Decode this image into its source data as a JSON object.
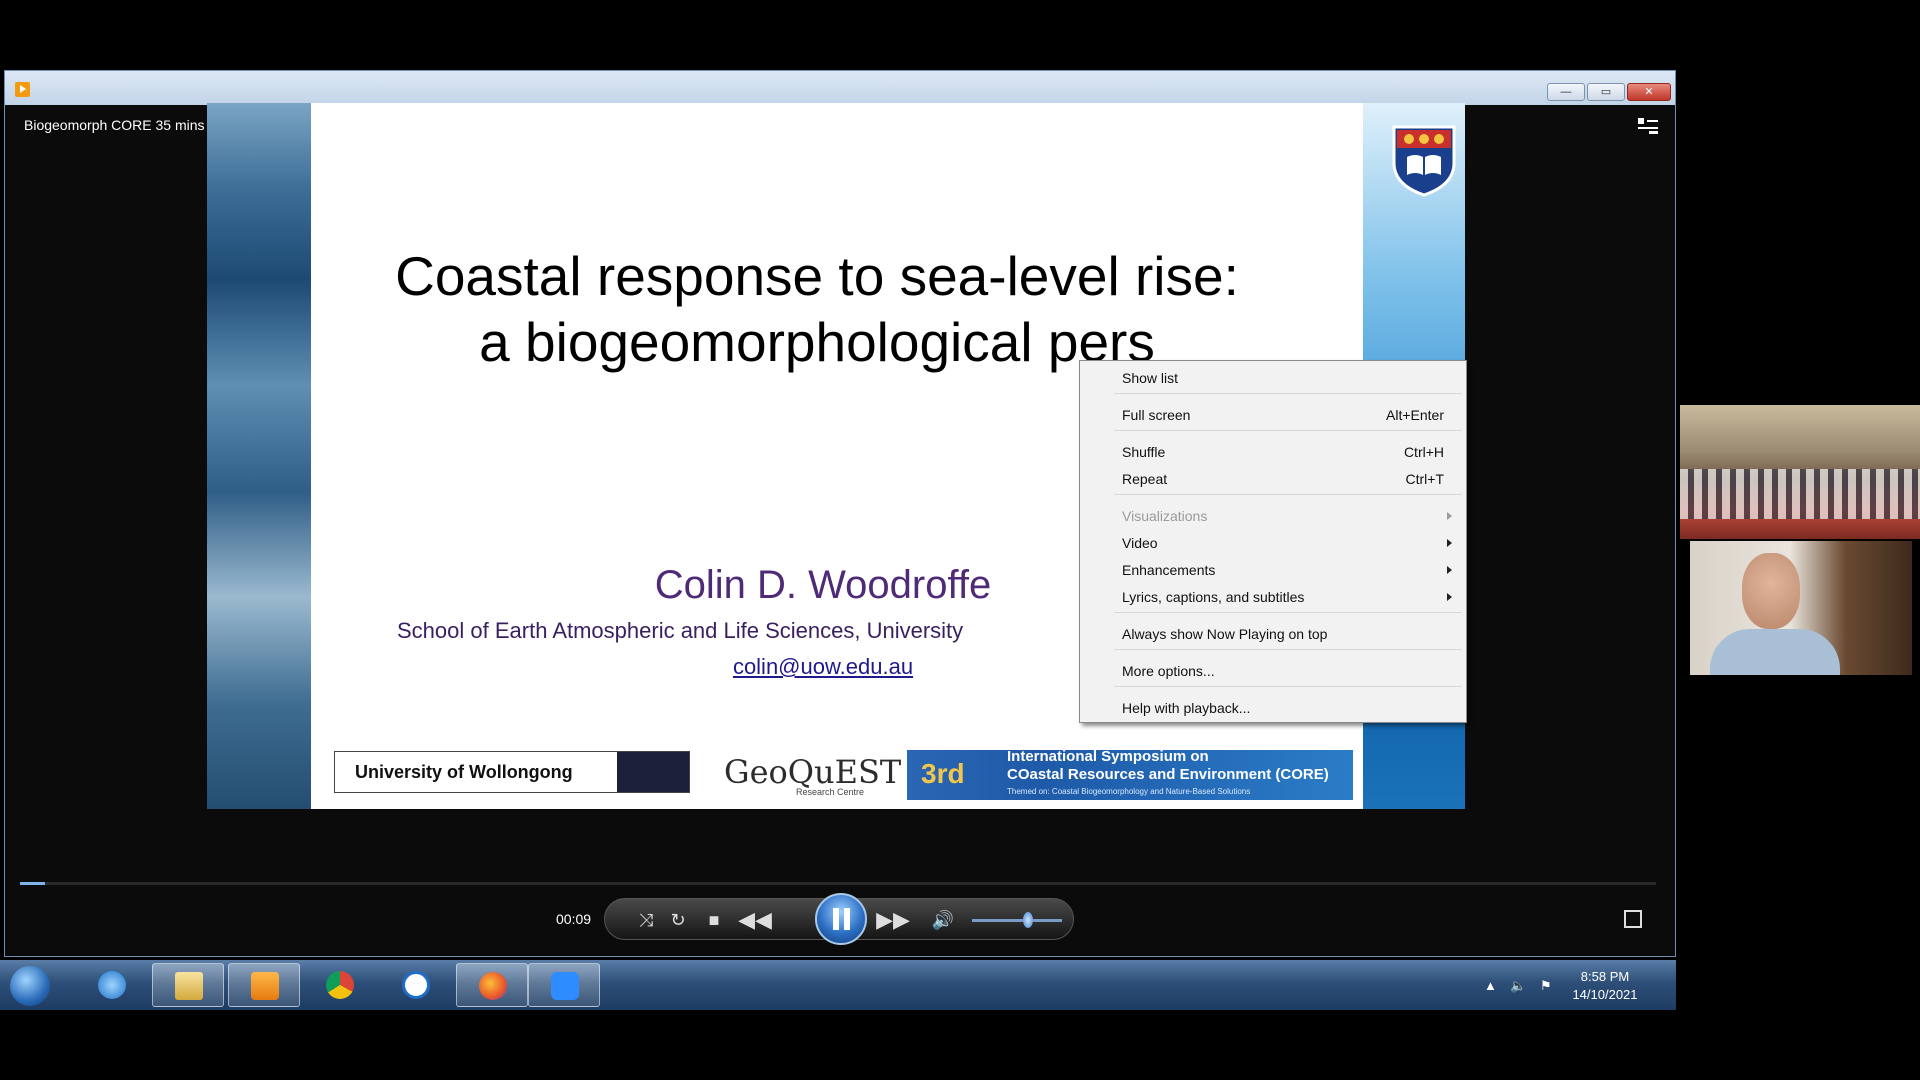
{
  "window": {
    "title": "Biogeomorph CORE 35 mins",
    "controls": {
      "minimize": "—",
      "maximize": "▭",
      "close": "✕"
    }
  },
  "slide": {
    "title": "Coastal response to sea-level rise:\na biogeomorphological pers",
    "author": "Colin D. Woodroffe",
    "affiliation": "School of Earth Atmospheric and Life Sciences, University",
    "email": "colin@uow.edu.au",
    "logos": {
      "uow": "University of Wollongong",
      "geoquest": "GeoQuEST",
      "geoquest_sub": "Research Centre",
      "core_ordinal": "3rd",
      "core_line1": "International Symposium on",
      "core_line2": "COastal Resources and Environment (CORE)",
      "core_line3": "Themed on: Coastal Biogeomorphology and Nature-Based Solutions"
    }
  },
  "context_menu": {
    "items": [
      {
        "label": "Show list",
        "shortcut": ""
      },
      {
        "label": "Full screen",
        "shortcut": "Alt+Enter"
      },
      {
        "label": "Shuffle",
        "shortcut": "Ctrl+H"
      },
      {
        "label": "Repeat",
        "shortcut": "Ctrl+T"
      },
      {
        "label": "Visualizations",
        "shortcut": ""
      },
      {
        "label": "Video",
        "shortcut": ""
      },
      {
        "label": "Enhancements",
        "shortcut": ""
      },
      {
        "label": "Lyrics, captions, and subtitles",
        "shortcut": ""
      },
      {
        "label": "Always show Now Playing on top",
        "shortcut": ""
      },
      {
        "label": "More options...",
        "shortcut": ""
      },
      {
        "label": "Help with playback...",
        "shortcut": ""
      }
    ]
  },
  "playback": {
    "time": "00:09",
    "progress_fraction": 0.015,
    "volume_fraction": 0.62,
    "icons": {
      "switch_view": "switch-view-icon",
      "shuffle": "shuffle-icon",
      "repeat": "repeat-icon",
      "stop": "stop-icon",
      "previous": "previous-icon",
      "pause": "pause-icon",
      "next": "next-icon",
      "volume": "volume-icon",
      "fullscreen": "fullscreen-icon"
    }
  },
  "taskbar": {
    "clock_time": "8:58 PM",
    "clock_date": "14/10/2021",
    "apps": [
      "internet-explorer",
      "file-explorer",
      "windows-media-player",
      "chrome",
      "teamviewer",
      "firefox",
      "zoom"
    ]
  }
}
